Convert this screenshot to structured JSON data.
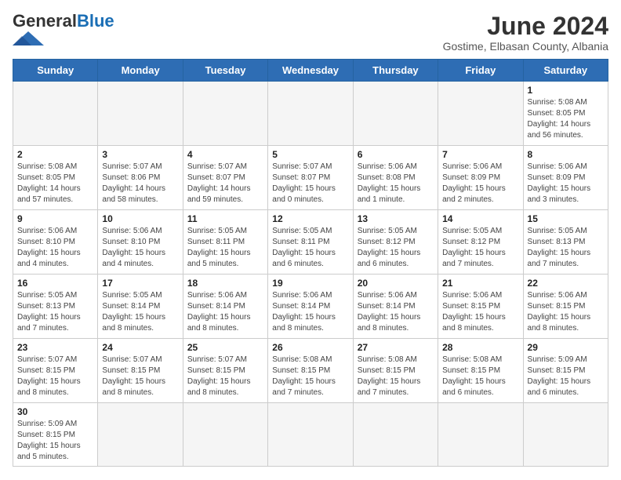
{
  "header": {
    "logo_general": "General",
    "logo_blue": "Blue",
    "month_title": "June 2024",
    "subtitle": "Gostime, Elbasan County, Albania"
  },
  "weekdays": [
    "Sunday",
    "Monday",
    "Tuesday",
    "Wednesday",
    "Thursday",
    "Friday",
    "Saturday"
  ],
  "weeks": [
    [
      {
        "day": "",
        "empty": true
      },
      {
        "day": "",
        "empty": true
      },
      {
        "day": "",
        "empty": true
      },
      {
        "day": "",
        "empty": true
      },
      {
        "day": "",
        "empty": true
      },
      {
        "day": "",
        "empty": true
      },
      {
        "day": "1",
        "info": "Sunrise: 5:08 AM\nSunset: 8:05 PM\nDaylight: 14 hours and 56 minutes."
      }
    ],
    [
      {
        "day": "2",
        "info": "Sunrise: 5:08 AM\nSunset: 8:05 PM\nDaylight: 14 hours and 57 minutes."
      },
      {
        "day": "3",
        "info": "Sunrise: 5:07 AM\nSunset: 8:06 PM\nDaylight: 14 hours and 58 minutes."
      },
      {
        "day": "4",
        "info": "Sunrise: 5:07 AM\nSunset: 8:07 PM\nDaylight: 14 hours and 59 minutes."
      },
      {
        "day": "5",
        "info": "Sunrise: 5:07 AM\nSunset: 8:07 PM\nDaylight: 15 hours and 0 minutes."
      },
      {
        "day": "6",
        "info": "Sunrise: 5:06 AM\nSunset: 8:08 PM\nDaylight: 15 hours and 1 minute."
      },
      {
        "day": "7",
        "info": "Sunrise: 5:06 AM\nSunset: 8:09 PM\nDaylight: 15 hours and 2 minutes."
      },
      {
        "day": "8",
        "info": "Sunrise: 5:06 AM\nSunset: 8:09 PM\nDaylight: 15 hours and 3 minutes."
      }
    ],
    [
      {
        "day": "9",
        "info": "Sunrise: 5:06 AM\nSunset: 8:10 PM\nDaylight: 15 hours and 4 minutes."
      },
      {
        "day": "10",
        "info": "Sunrise: 5:06 AM\nSunset: 8:10 PM\nDaylight: 15 hours and 4 minutes."
      },
      {
        "day": "11",
        "info": "Sunrise: 5:05 AM\nSunset: 8:11 PM\nDaylight: 15 hours and 5 minutes."
      },
      {
        "day": "12",
        "info": "Sunrise: 5:05 AM\nSunset: 8:11 PM\nDaylight: 15 hours and 6 minutes."
      },
      {
        "day": "13",
        "info": "Sunrise: 5:05 AM\nSunset: 8:12 PM\nDaylight: 15 hours and 6 minutes."
      },
      {
        "day": "14",
        "info": "Sunrise: 5:05 AM\nSunset: 8:12 PM\nDaylight: 15 hours and 7 minutes."
      },
      {
        "day": "15",
        "info": "Sunrise: 5:05 AM\nSunset: 8:13 PM\nDaylight: 15 hours and 7 minutes."
      }
    ],
    [
      {
        "day": "16",
        "info": "Sunrise: 5:05 AM\nSunset: 8:13 PM\nDaylight: 15 hours and 7 minutes."
      },
      {
        "day": "17",
        "info": "Sunrise: 5:05 AM\nSunset: 8:14 PM\nDaylight: 15 hours and 8 minutes."
      },
      {
        "day": "18",
        "info": "Sunrise: 5:06 AM\nSunset: 8:14 PM\nDaylight: 15 hours and 8 minutes."
      },
      {
        "day": "19",
        "info": "Sunrise: 5:06 AM\nSunset: 8:14 PM\nDaylight: 15 hours and 8 minutes."
      },
      {
        "day": "20",
        "info": "Sunrise: 5:06 AM\nSunset: 8:14 PM\nDaylight: 15 hours and 8 minutes."
      },
      {
        "day": "21",
        "info": "Sunrise: 5:06 AM\nSunset: 8:15 PM\nDaylight: 15 hours and 8 minutes."
      },
      {
        "day": "22",
        "info": "Sunrise: 5:06 AM\nSunset: 8:15 PM\nDaylight: 15 hours and 8 minutes."
      }
    ],
    [
      {
        "day": "23",
        "info": "Sunrise: 5:07 AM\nSunset: 8:15 PM\nDaylight: 15 hours and 8 minutes."
      },
      {
        "day": "24",
        "info": "Sunrise: 5:07 AM\nSunset: 8:15 PM\nDaylight: 15 hours and 8 minutes."
      },
      {
        "day": "25",
        "info": "Sunrise: 5:07 AM\nSunset: 8:15 PM\nDaylight: 15 hours and 8 minutes."
      },
      {
        "day": "26",
        "info": "Sunrise: 5:08 AM\nSunset: 8:15 PM\nDaylight: 15 hours and 7 minutes."
      },
      {
        "day": "27",
        "info": "Sunrise: 5:08 AM\nSunset: 8:15 PM\nDaylight: 15 hours and 7 minutes."
      },
      {
        "day": "28",
        "info": "Sunrise: 5:08 AM\nSunset: 8:15 PM\nDaylight: 15 hours and 6 minutes."
      },
      {
        "day": "29",
        "info": "Sunrise: 5:09 AM\nSunset: 8:15 PM\nDaylight: 15 hours and 6 minutes."
      }
    ],
    [
      {
        "day": "30",
        "info": "Sunrise: 5:09 AM\nSunset: 8:15 PM\nDaylight: 15 hours and 5 minutes."
      },
      {
        "day": "",
        "empty": true
      },
      {
        "day": "",
        "empty": true
      },
      {
        "day": "",
        "empty": true
      },
      {
        "day": "",
        "empty": true
      },
      {
        "day": "",
        "empty": true
      },
      {
        "day": "",
        "empty": true
      }
    ]
  ]
}
